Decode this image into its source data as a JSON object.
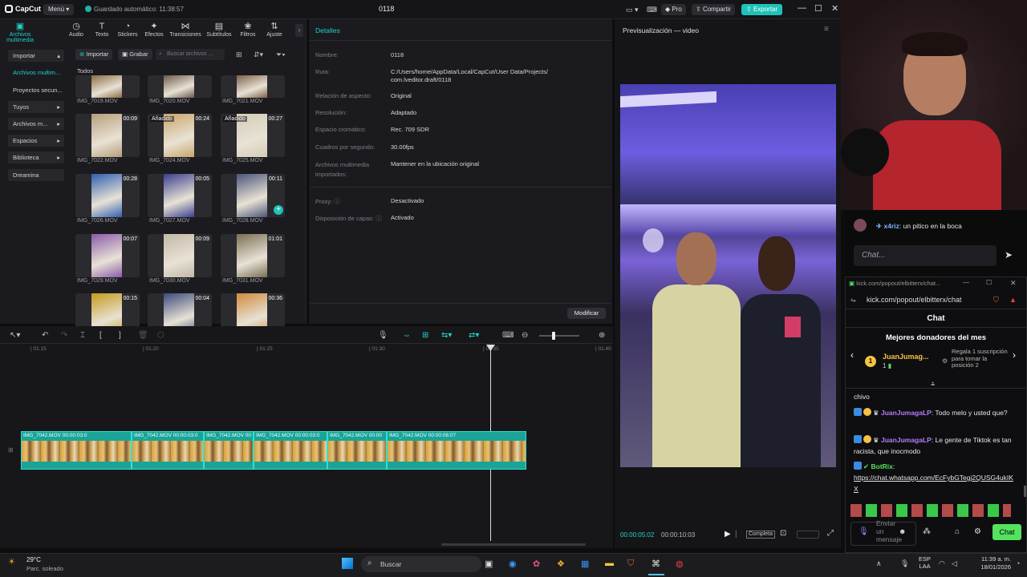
{
  "app": {
    "logo": "CapCut",
    "menu_label": "Menú",
    "autosave": "Guardado automático: 11:38:57",
    "project_title": "0118",
    "pro_label": "Pro",
    "share_label": "Compartir",
    "export_label": "Exportar",
    "accent": "#1ec2b8"
  },
  "tools": [
    {
      "label": "Archivos multimedia",
      "icon": "media-icon"
    },
    {
      "label": "Audio",
      "icon": "audio-icon"
    },
    {
      "label": "Texto",
      "icon": "text-icon"
    },
    {
      "label": "Stickers",
      "icon": "sticker-icon"
    },
    {
      "label": "Efectos",
      "icon": "effects-icon"
    },
    {
      "label": "Transiciones",
      "icon": "transitions-icon"
    },
    {
      "label": "Subtítulos",
      "icon": "subtitles-icon"
    },
    {
      "label": "Filtros",
      "icon": "filters-icon"
    },
    {
      "label": "Ajuste",
      "icon": "adjust-icon"
    }
  ],
  "sidebar": [
    {
      "label": "Importar"
    },
    {
      "label": "Archivos multim..."
    },
    {
      "label": "Proyectos secun..."
    },
    {
      "label": "Tuyos"
    },
    {
      "label": "Archivos m..."
    },
    {
      "label": "Espacios"
    },
    {
      "label": "Biblioteca"
    },
    {
      "label": "Dreamina"
    }
  ],
  "media": {
    "import_label": "Importar",
    "record_label": "Grabar",
    "search_placeholder": "Buscar archivos ...",
    "section_label": "Todos",
    "items": [
      {
        "name": "IMG_7019.MOV",
        "dur": "",
        "added": ""
      },
      {
        "name": "IMG_7020.MOV",
        "dur": "",
        "added": ""
      },
      {
        "name": "IMG_7021.MOV",
        "dur": "",
        "added": ""
      },
      {
        "name": "IMG_7022.MOV",
        "dur": "00:09",
        "added": ""
      },
      {
        "name": "IMG_7024.MOV",
        "dur": "00:24",
        "added": "Añadido"
      },
      {
        "name": "IMG_7025.MOV",
        "dur": "00:27",
        "added": "Añadido"
      },
      {
        "name": "IMG_7026.MOV",
        "dur": "00:28",
        "added": ""
      },
      {
        "name": "IMG_7027.MOV",
        "dur": "00:05",
        "added": ""
      },
      {
        "name": "IMG_7028.MOV",
        "dur": "00:11",
        "added": ""
      },
      {
        "name": "IMG_7029.MOV",
        "dur": "00:07",
        "added": ""
      },
      {
        "name": "IMG_7030.MOV",
        "dur": "00:09",
        "added": ""
      },
      {
        "name": "IMG_7031.MOV",
        "dur": "01:01",
        "added": ""
      },
      {
        "name": "",
        "dur": "00:15",
        "added": ""
      },
      {
        "name": "",
        "dur": "00:04",
        "added": ""
      },
      {
        "name": "",
        "dur": "00:36",
        "added": ""
      }
    ]
  },
  "details": {
    "title": "Detalles",
    "rows": [
      {
        "label": "Nombre:",
        "value": "0118"
      },
      {
        "label": "Ruta:",
        "value": "C:/Users/home/AppData/Local/CapCut/User Data/Projects/ com.lveditor.draft/0118"
      },
      {
        "label": "Relación de aspecto:",
        "value": "Original"
      },
      {
        "label": "Resolución:",
        "value": "Adaptado"
      },
      {
        "label": "Espacio cromático:",
        "value": "Rec. 709 SDR"
      },
      {
        "label": "Cuadros por segundo:",
        "value": "30.00fps"
      },
      {
        "label": "Archivos multimedia importados:",
        "value": "Mantener en la ubicación original"
      },
      {
        "label": "Proxy:",
        "value": "Desactivado"
      },
      {
        "label": "Disposición de capas:",
        "value": "Activado"
      }
    ],
    "modify_label": "Modificar"
  },
  "preview": {
    "title": "Previsualización — video",
    "current_time": "00:00:05:02",
    "total_time": "00:00:10:03",
    "full_label": "Completa"
  },
  "timeline": {
    "ruler": [
      "01:15",
      "01:20",
      "01:25",
      "01:30",
      "01:35",
      "01:40"
    ],
    "clips": [
      {
        "label": "IMG_7042.MOV  00:00:03:0"
      },
      {
        "label": "IMG_7042.MOV  00:00:03:0"
      },
      {
        "label": "IMG_7042.MOV  00"
      },
      {
        "label": "IMG_7042.MOV  00:00:03:0"
      },
      {
        "label": "IMG_7042.MOV  00:00"
      },
      {
        "label": "IMG_7042.MOV  00:00:06:07"
      }
    ]
  },
  "chat": {
    "top_msg_user": "x4riz",
    "top_msg_text": "un pitico en la boca",
    "input_placeholder": "Chat...",
    "popout_title": "kick.com/popout/elbitterx/chat...",
    "url": "kick.com/popout/elbitterx/chat",
    "header": "Chat",
    "donors_title": "Mejores donadores del mes",
    "donor_name": "JuanJumag...",
    "donor_count": "1",
    "donor_info": "Regala 1 suscripción para tomar la posición 2",
    "messages": [
      {
        "user": "",
        "text": "chivo"
      },
      {
        "user": "JuanJumagaLP",
        "text": "Todo melo y usted que?"
      },
      {
        "user": "JuanJumagaLP",
        "text": "Le gente de Tiktok es tan racista, que inocmodo"
      },
      {
        "user": "BotRix",
        "text": "https://chat.whatsapp.com/EcFybGTegj2QUSG4ukIKX"
      }
    ],
    "send_placeholder": "Enviar un mensaje",
    "chat_button": "Chat"
  },
  "taskbar": {
    "weather_temp": "29°C",
    "weather_text": "Parc. soleado",
    "search_label": "Buscar",
    "lang_top": "ESP",
    "lang_bottom": "LAA",
    "time": "11:39 a. m.",
    "date": "18/01/2026"
  }
}
